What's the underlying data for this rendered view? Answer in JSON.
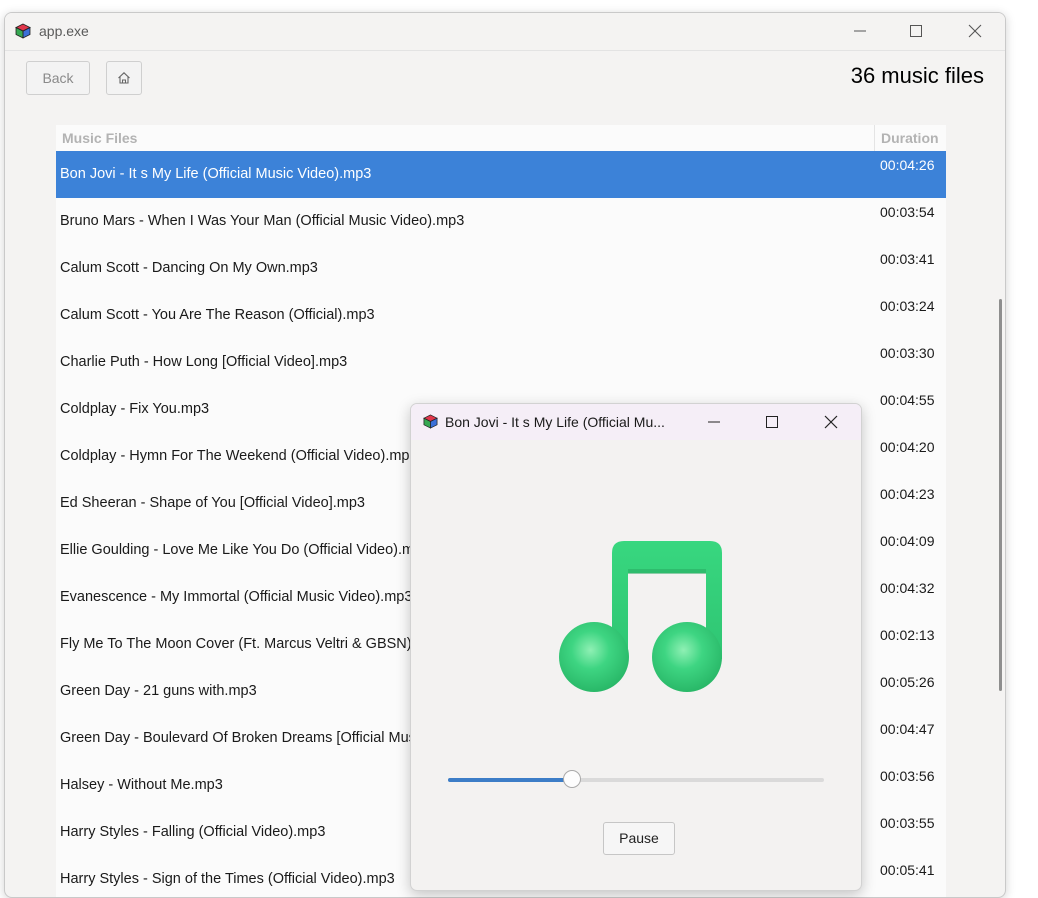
{
  "window": {
    "title": "app.exe"
  },
  "toolbar": {
    "back_label": "Back",
    "home_icon": "home-icon",
    "count_label": "36 music files"
  },
  "table": {
    "columns": [
      "Music Files",
      "Duration"
    ],
    "selected_index": 0,
    "rows": [
      {
        "name": "Bon Jovi - It s My Life (Official Music Video).mp3",
        "duration": "00:04:26"
      },
      {
        "name": "Bruno Mars - When I Was Your Man (Official Music Video).mp3",
        "duration": "00:03:54"
      },
      {
        "name": "Calum Scott - Dancing On My Own.mp3",
        "duration": "00:03:41"
      },
      {
        "name": "Calum Scott - You Are The Reason (Official).mp3",
        "duration": "00:03:24"
      },
      {
        "name": "Charlie Puth - How Long [Official Video].mp3",
        "duration": "00:03:30"
      },
      {
        "name": "Coldplay - Fix You.mp3",
        "duration": "00:04:55"
      },
      {
        "name": "Coldplay - Hymn For The Weekend (Official Video).mp3",
        "duration": "00:04:20"
      },
      {
        "name": "Ed Sheeran - Shape of You [Official Video].mp3",
        "duration": "00:04:23"
      },
      {
        "name": "Ellie Goulding - Love Me Like You Do (Official Video).mp3",
        "duration": "00:04:09"
      },
      {
        "name": "Evanescence - My Immortal (Official Music Video).mp3",
        "duration": "00:04:32"
      },
      {
        "name": "Fly Me To The Moon Cover (Ft. Marcus Veltri & GBSN).mp3",
        "duration": "00:02:13"
      },
      {
        "name": "Green Day - 21 guns with.mp3",
        "duration": "00:05:26"
      },
      {
        "name": "Green Day - Boulevard Of Broken Dreams [Official Music Video].mp3",
        "duration": "00:04:47"
      },
      {
        "name": "Halsey - Without Me.mp3",
        "duration": "00:03:56"
      },
      {
        "name": "Harry Styles - Falling (Official Video).mp3",
        "duration": "00:03:55"
      },
      {
        "name": "Harry Styles - Sign of the Times (Official Video).mp3",
        "duration": "00:05:41"
      }
    ]
  },
  "player": {
    "title": "Bon Jovi - It s My Life (Official Mu...",
    "art_icon": "music-note-icon",
    "progress": 0.33,
    "pause_label": "Pause"
  },
  "colors": {
    "selection": "#3c82d8",
    "note_green": "#33d17a",
    "slider_fill": "#3c7dc7"
  }
}
